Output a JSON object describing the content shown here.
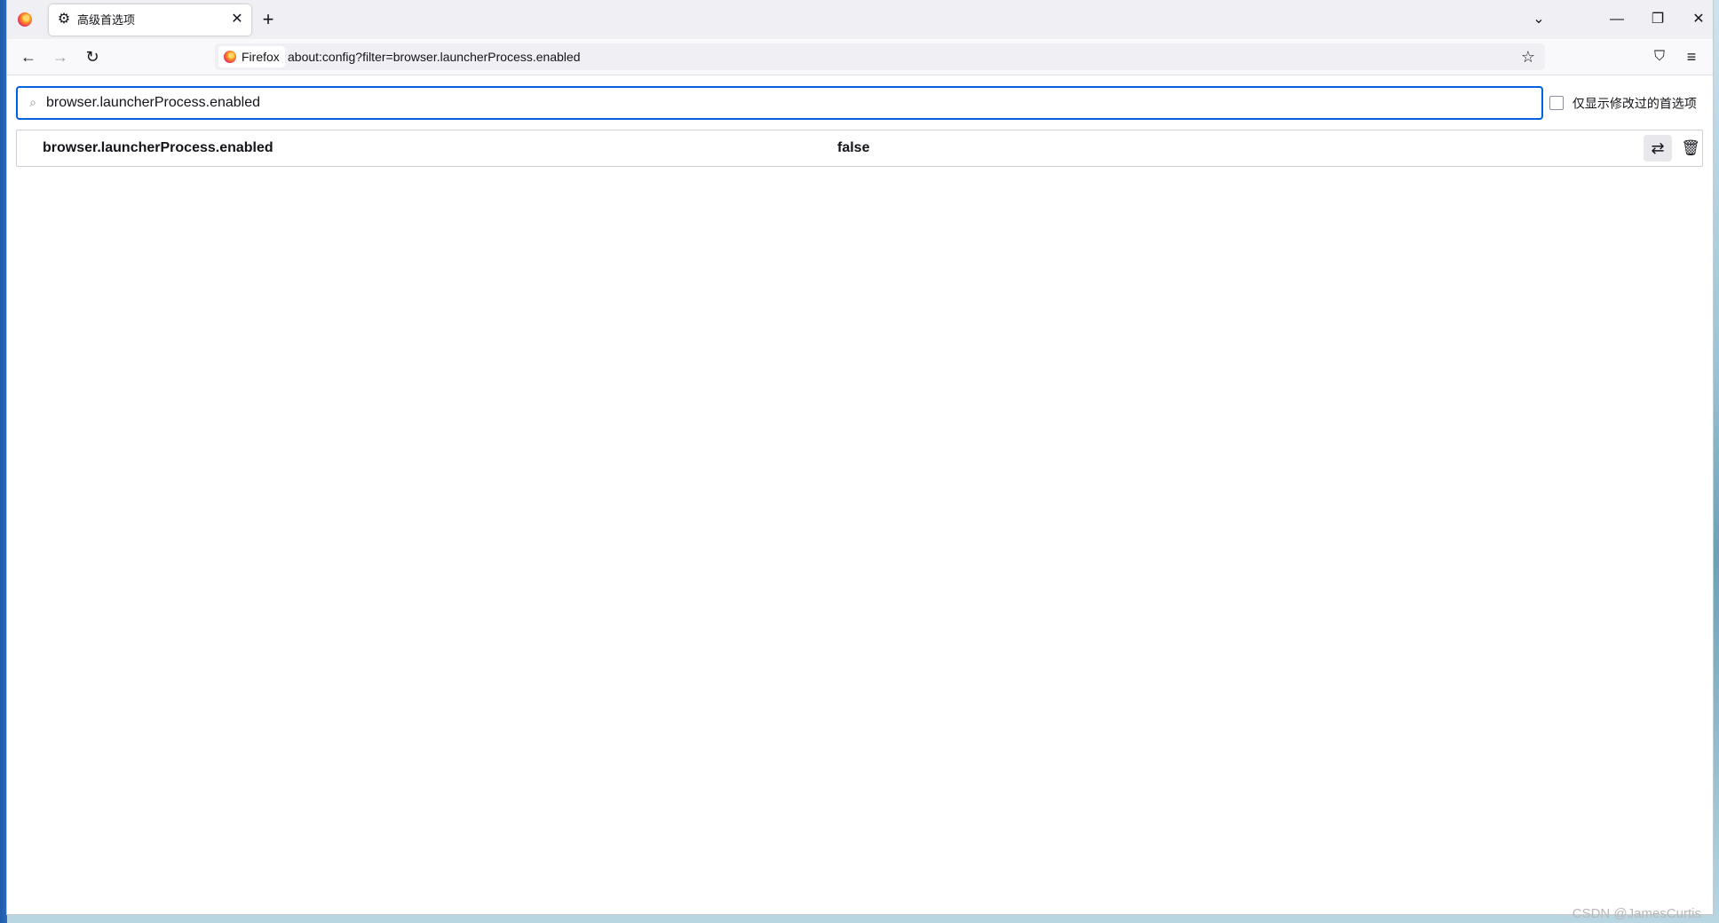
{
  "tabs": [
    {
      "title": "高级首选项",
      "icon": "gear-icon"
    }
  ],
  "toolbar": {
    "identity_label": "Firefox",
    "url": "about:config?filter=browser.launcherProcess.enabled"
  },
  "search": {
    "value": "browser.launcherProcess.enabled"
  },
  "filters": {
    "modified_only_label": "仅显示修改过的首选项",
    "modified_only_checked": false
  },
  "preferences": [
    {
      "name": "browser.launcherProcess.enabled",
      "value": "false"
    }
  ],
  "watermark": "CSDN @JamesCurtis",
  "colors": {
    "accent": "#0061e0",
    "tab_strip_bg": "#f0f0f4",
    "toggle_bg": "#e8e8ec"
  }
}
